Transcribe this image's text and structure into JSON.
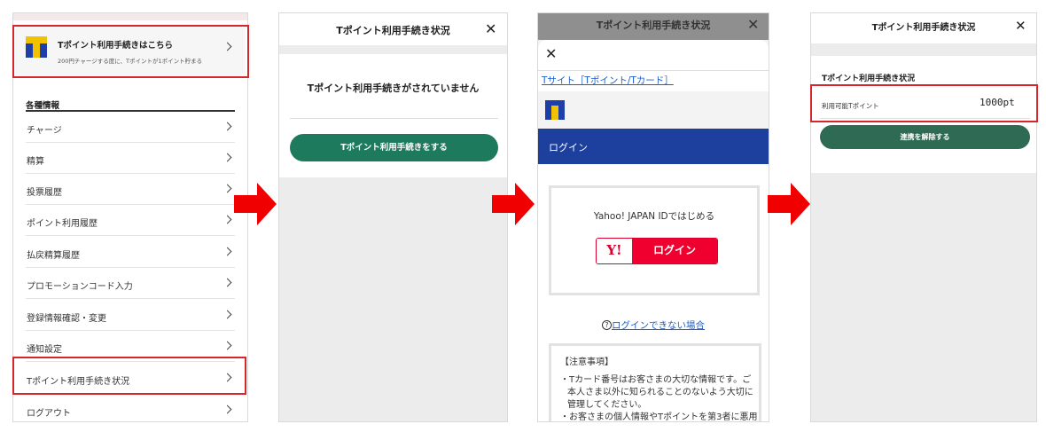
{
  "panel1": {
    "tpoint_card": {
      "title": "Tポイント利用手続きはこちら",
      "subtitle": "200円チャージする度に、Tポイントが1ポイント貯まる"
    },
    "section_heading": "各種情報",
    "menu_items": [
      {
        "label": "チャージ"
      },
      {
        "label": "精算"
      },
      {
        "label": "投票履歴"
      },
      {
        "label": "ポイント利用履歴"
      },
      {
        "label": "払戻精算履歴"
      },
      {
        "label": "プロモーションコード入力"
      },
      {
        "label": "登録情報確認・変更"
      },
      {
        "label": "通知設定"
      },
      {
        "label": "Tポイント利用手続き状況"
      },
      {
        "label": "ログアウト"
      }
    ]
  },
  "panel2": {
    "header_title": "Tポイント利用手続き状況",
    "close_glyph": "✕",
    "status_message": "Tポイント利用手続きがされていません",
    "action_button": "Tポイント利用手続きをする"
  },
  "panel3": {
    "bg_header_title": "Tポイント利用手続き状況",
    "close_glyph": "✕",
    "tsite_link": "Tサイト［Tポイント/Tカード］",
    "login_bar_label": "ログイン",
    "yahoo_prompt": "Yahoo! JAPAN IDではじめる",
    "yahoo_logo": "Y!",
    "yahoo_login_label": "ログイン",
    "help_icon": "?",
    "help_link": "ログインできない場合",
    "notice_title": "【注意事項】",
    "notice_text": "・Tカード番号はお客さまの大切な情報です。ご本人さま以外に知られることのないよう大切に管理してください。",
    "notice_text2": "・お客さまの個人情報やTポイントを第3者に悪用"
  },
  "panel4": {
    "header_title": "Tポイント利用手続き状況",
    "close_glyph": "✕",
    "section_title": "Tポイント利用手続き状況",
    "points_label": "利用可能Tポイント",
    "points_value": "1000pt",
    "unlink_button": "連携を解除する"
  },
  "colors": {
    "highlight_red": "#d6262c",
    "arrow_red": "#f00000",
    "primary_green": "#1e7a5c",
    "login_bar_blue": "#1d3f9e",
    "yahoo_red": "#f0002f"
  }
}
